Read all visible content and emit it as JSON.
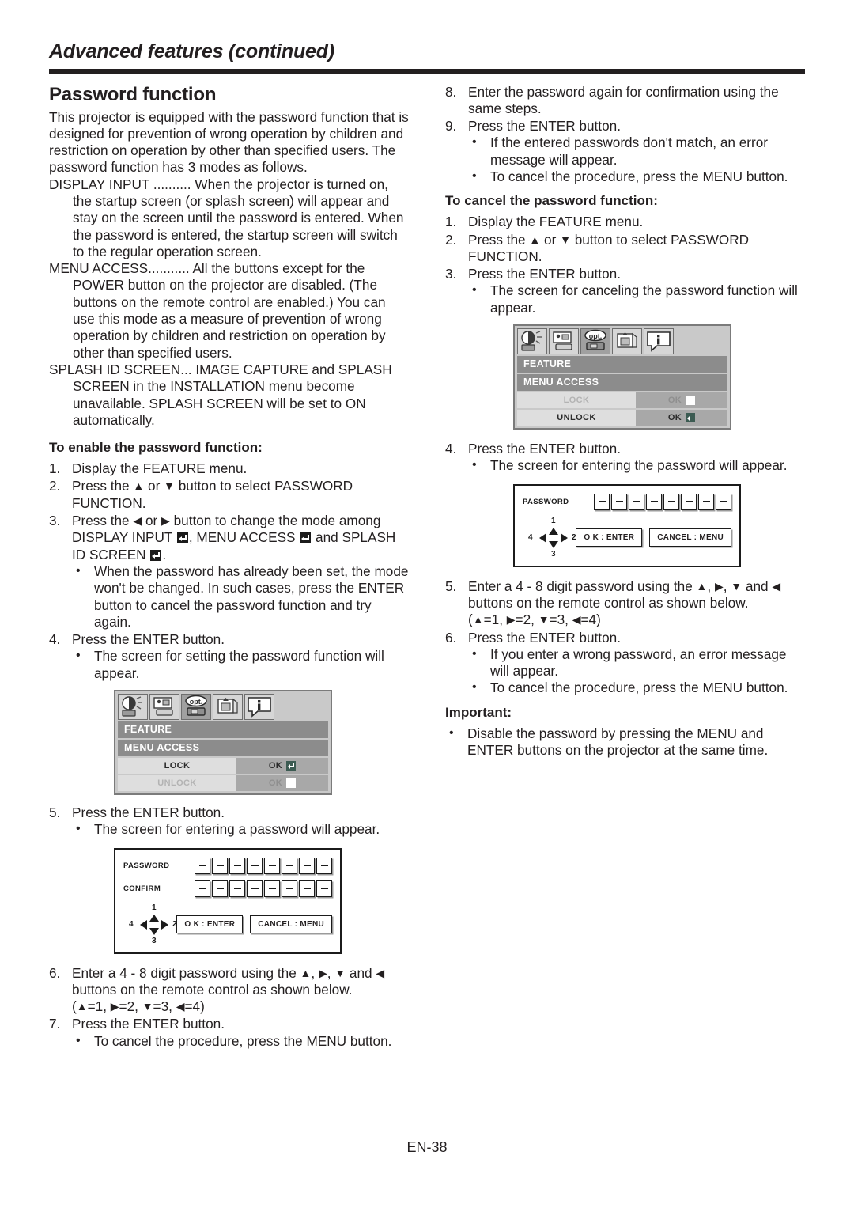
{
  "header": {
    "chapter_title": "Advanced features (continued)"
  },
  "left_column": {
    "section_title": "Password function",
    "intro": "This projector is equipped with the password function that is designed for prevention of wrong operation by children and restriction on operation by other than specified users. The password function has 3 modes as follows.",
    "modes": [
      {
        "name": "DISPLAY INPUT ..........",
        "desc": "When the projector is turned on, the startup screen (or splash screen) will appear and stay on the screen until the password is entered. When the password is entered, the startup screen will switch to the regular operation screen."
      },
      {
        "name": "MENU ACCESS...........",
        "desc": "All the buttons except for the POWER button on the projector are disabled. (The buttons on the remote control are enabled.) You can use this mode as a measure of prevention of wrong operation by children and restriction on operation by other than specified users."
      },
      {
        "name": "SPLASH ID SCREEN...",
        "desc": "IMAGE CAPTURE and SPLASH SCREEN in the INSTALLATION menu become unavailable. SPLASH SCREEN will be set to ON automatically."
      }
    ],
    "enable_heading": "To enable the password function:",
    "step1": "Display the FEATURE menu.",
    "step1_num": "1.",
    "step2_num": "2.",
    "step2_a": "Press the ",
    "step2_b": " or ",
    "step2_c": " button to select PASSWORD FUNCTION.",
    "step3_num": "3.",
    "step3_a": "Press the ",
    "step3_b": " or ",
    "step3_c": " button to change the mode among DISPLAY INPUT ",
    "step3_d": ", MENU ACCESS ",
    "step3_e": " and SPLASH ID SCREEN ",
    "step3_f": ".",
    "step3_bullet": "When the password has already been set, the mode won't be changed. In such cases, press the ENTER button to cancel the password function and try again.",
    "step4_num": "4.",
    "step4": "Press the ENTER button.",
    "step4_bullet": "The screen for setting the password function will appear.",
    "step5_num": "5.",
    "step5": "Press the ENTER button.",
    "step5_bullet": "The screen for entering a password will appear.",
    "step6_num": "6.",
    "step6_a": "Enter a 4 - 8 digit password using the ",
    "step6_b": ", ",
    "step6_c": ", ",
    "step6_d": " and ",
    "step6_e": " buttons on the remote control as shown below.",
    "step6_legend_open": "(",
    "step6_legend_1": "=1, ",
    "step6_legend_2": "=2, ",
    "step6_legend_3": "=3, ",
    "step6_legend_4": "=4)",
    "step7_num": "7.",
    "step7": "Press the ENTER button.",
    "step7_bullet": "To cancel the procedure, press the MENU button."
  },
  "right_column": {
    "step8_num": "8.",
    "step8": "Enter the password again for confirmation using the same steps.",
    "step9_num": "9.",
    "step9": "Press the ENTER button.",
    "step9_bullet1": "If the entered passwords don't match, an error message will appear.",
    "step9_bullet2": "To cancel the procedure, press the MENU button.",
    "cancel_heading": "To cancel the password function:",
    "c1_num": "1.",
    "c1": "Display the FEATURE menu.",
    "c2_num": "2.",
    "c2_a": "Press the ",
    "c2_b": " or ",
    "c2_c": " button to select PASSWORD FUNCTION.",
    "c3_num": "3.",
    "c3": "Press the ENTER button.",
    "c3_bullet": "The screen for canceling the password function will appear.",
    "c4_num": "4.",
    "c4": "Press the ENTER button.",
    "c4_bullet": "The screen for entering the password will appear.",
    "c5_num": "5.",
    "c5_a": "Enter a 4 - 8 digit password using the ",
    "c5_b": ", ",
    "c5_c": ", ",
    "c5_d": " and ",
    "c5_e": " buttons on the remote control as shown below.",
    "c5_legend_open": "(",
    "c5_legend_1": "=1, ",
    "c5_legend_2": "=2, ",
    "c5_legend_3": "=3, ",
    "c5_legend_4": "=4)",
    "c6_num": "6.",
    "c6": "Press the ENTER button.",
    "c6_bullet1": "If you enter a wrong password, an error message will appear.",
    "c6_bullet2": "To cancel the procedure, press the MENU button.",
    "important_heading": "Important:",
    "important_bullet": "Disable the password by pressing the MENU and ENTER buttons on the projector at the same time."
  },
  "arrows": {
    "up": "▲",
    "down": "▼",
    "left": "◀",
    "right": "▶"
  },
  "osd_menu_left": {
    "tabs": [
      "image-tab",
      "video-tab",
      "opt-tab",
      "installation-tab",
      "info-tab"
    ],
    "selected_tab_label": "opt.",
    "title": "FEATURE",
    "subtitle": "MENU ACCESS",
    "rows": [
      {
        "label": "LOCK",
        "value": "OK",
        "mark": "enter",
        "disabled": false
      },
      {
        "label": "UNLOCK",
        "value": "OK",
        "mark": "blank",
        "disabled": true
      }
    ]
  },
  "osd_menu_right": {
    "tabs": [
      "image-tab",
      "video-tab",
      "opt-tab",
      "installation-tab",
      "info-tab"
    ],
    "selected_tab_label": "opt.",
    "title": "FEATURE",
    "subtitle": "MENU ACCESS",
    "rows": [
      {
        "label": "LOCK",
        "value": "OK",
        "mark": "blank",
        "disabled": true
      },
      {
        "label": "UNLOCK",
        "value": "OK",
        "mark": "enter",
        "disabled": false
      }
    ]
  },
  "password_screen_left": {
    "rows": [
      {
        "label": "PASSWORD",
        "cells": 8
      },
      {
        "label": "CONFIRM",
        "cells": 8
      }
    ],
    "dpad": {
      "up": "1",
      "right": "2",
      "down": "3",
      "left": "4"
    },
    "ok_button": "O K : ENTER",
    "cancel_button": "CANCEL : MENU"
  },
  "password_screen_right": {
    "rows": [
      {
        "label": "PASSWORD",
        "cells": 8
      }
    ],
    "dpad": {
      "up": "1",
      "right": "2",
      "down": "3",
      "left": "4"
    },
    "ok_button": "O K : ENTER",
    "cancel_button": "CANCEL : MENU"
  },
  "footer": {
    "page_number": "EN-38"
  }
}
